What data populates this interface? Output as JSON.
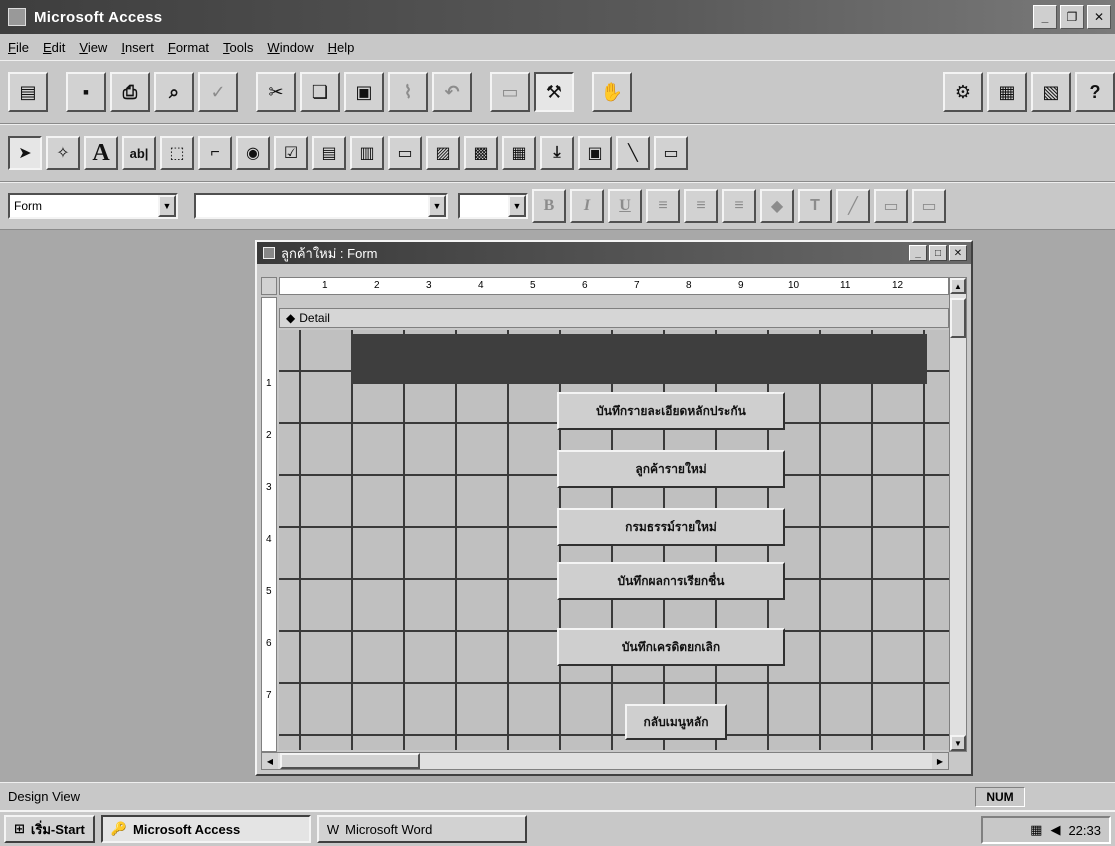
{
  "app": {
    "title": "Microsoft Access"
  },
  "menu": [
    "File",
    "Edit",
    "View",
    "Insert",
    "Format",
    "Tools",
    "Window",
    "Help"
  ],
  "format_bar": {
    "object_value": "Form",
    "font_value": "",
    "size_value": "",
    "bold": "B",
    "italic": "I",
    "underline": "U"
  },
  "form_window": {
    "title": "ลูกค้าใหม่ : Form",
    "ruler_marks": [
      "1",
      "2",
      "3",
      "4",
      "5",
      "6",
      "7",
      "8",
      "9",
      "10",
      "11",
      "12"
    ],
    "vruler_marks": [
      "1",
      "2",
      "3",
      "4",
      "5",
      "6",
      "7"
    ],
    "section": "Detail",
    "buttons": [
      "บันทึกรายละเอียดหลักประกัน",
      "ลูกค้ารายใหม่",
      "กรมธรรม์รายใหม่",
      "บันทึกผลการเรียกชื่น",
      "บันทึกเครดิตยกเลิก",
      "กลับเมนูหลัก"
    ]
  },
  "status": {
    "text": "Design View",
    "num": "NUM"
  },
  "taskbar": {
    "start": "เริ่ม-Start",
    "tasks": [
      "Microsoft Access",
      "Microsoft Word"
    ],
    "clock": "22:33"
  }
}
